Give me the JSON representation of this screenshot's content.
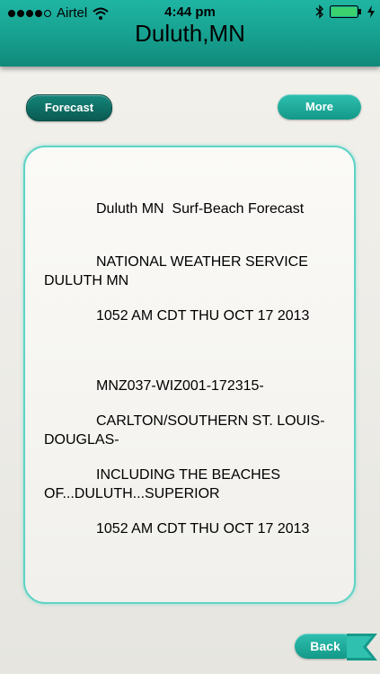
{
  "status_bar": {
    "carrier": "Airtel",
    "time": "4:44 pm",
    "signal_bars": 4,
    "signal_total": 5
  },
  "header": {
    "title": "Duluth,MN"
  },
  "buttons": {
    "forecast": "Forecast",
    "more": "More",
    "back": "Back"
  },
  "forecast": {
    "lines": [
      "Duluth MN  Surf-Beach Forecast",
      "NATIONAL WEATHER SERVICE DULUTH MN",
      "1052 AM CDT THU OCT 17 2013",
      "MNZ037-WIZ001-172315-",
      "CARLTON/SOUTHERN ST. LOUIS-DOUGLAS-",
      "INCLUDING THE BEACHES OF...DULUTH...SUPERIOR",
      "1052 AM CDT THU OCT 17 2013"
    ]
  },
  "colors": {
    "accent": "#17a08f",
    "border": "#5fd3c6"
  }
}
